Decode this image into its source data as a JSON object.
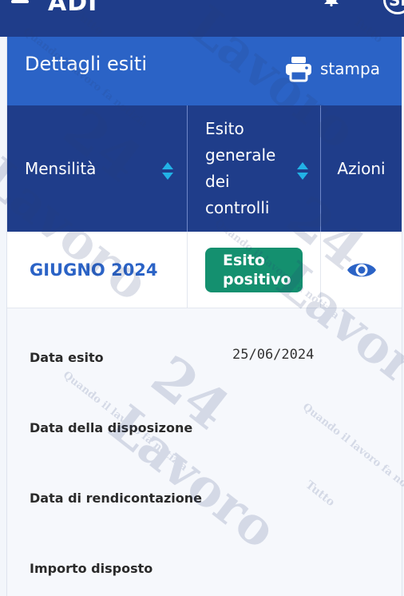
{
  "app": {
    "brand": "ADI",
    "avatar_initials": "SI"
  },
  "card": {
    "title": "Dettagli esiti",
    "print_label": "stampa"
  },
  "table": {
    "headers": {
      "month": "Mensilità",
      "outcome": [
        "Esito",
        "generale",
        "dei",
        "controlli"
      ],
      "actions": "Azioni"
    },
    "row": {
      "month": "GIUGNO 2024",
      "outcome_badge": [
        "Esito",
        "positivo"
      ]
    }
  },
  "details": {
    "data_esito": {
      "label": "Data esito",
      "value": "25/06/2024"
    },
    "data_disposizione": {
      "label": "Data della disposizone",
      "value": ""
    },
    "data_rendicontazione": {
      "label": "Data di rendicontazione",
      "value": ""
    },
    "importo_disposto": {
      "label": "Importo disposto",
      "value": ""
    }
  },
  "watermark": {
    "word": "Lavoro",
    "number": "24",
    "tagline": "Quando il lavoro fa notizia",
    "tutto": "Tutto"
  },
  "colors": {
    "header_blue": "#2b63c6",
    "table_head_navy": "#1f3d8a",
    "sort_cyan": "#22b2e6",
    "badge_green": "#14906f",
    "eye_blue": "#2b63c6"
  }
}
